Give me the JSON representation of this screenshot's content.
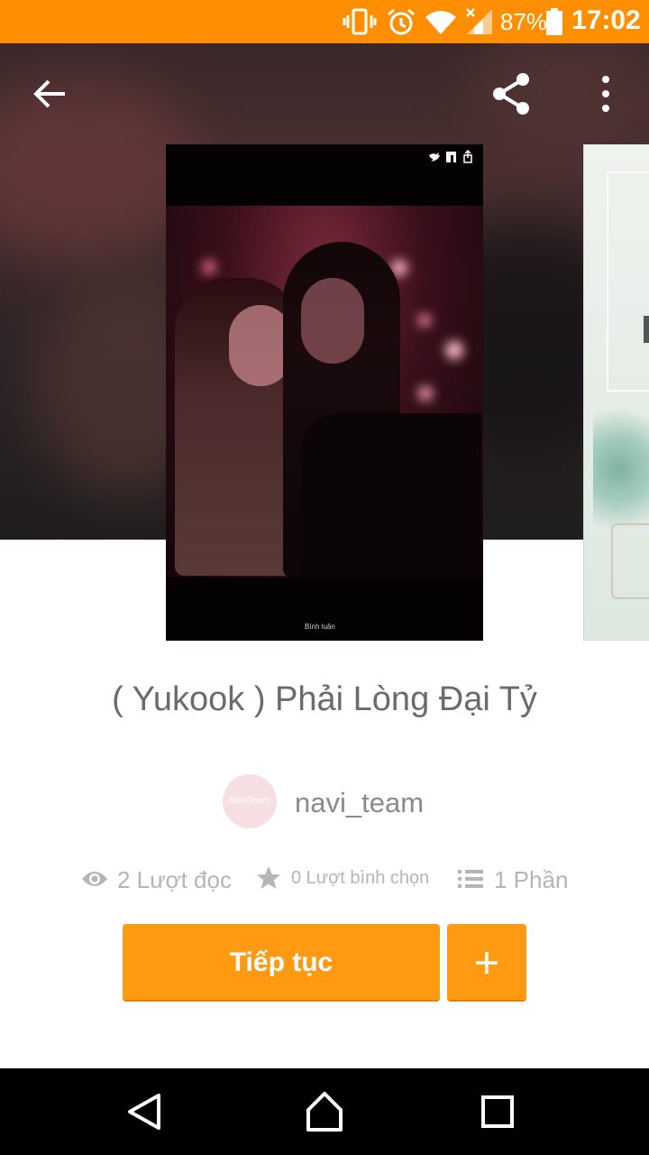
{
  "status_bar": {
    "icons": [
      "vibrate-icon",
      "alarm-icon",
      "wifi-icon",
      "signal-icon",
      "battery-icon"
    ],
    "battery": "87%",
    "time": "17:02"
  },
  "top_bar": {
    "back_icon": "arrow-left-icon",
    "share_icon": "share-icon",
    "more_icon": "more-vert-icon"
  },
  "cover": {
    "comment_label": "Bình luận"
  },
  "story": {
    "title": "( Yukook ) Phải Lòng Đại Tỷ",
    "author": "navi_team",
    "avatar_text": "NaviTeam"
  },
  "stats": {
    "reads": "2 Lượt đọc",
    "votes": "0 Lượt bình chọn",
    "parts": "1 Phần"
  },
  "actions": {
    "continue_label": "Tiếp tục",
    "add_icon": "plus-icon"
  },
  "colors": {
    "accent": "#ff9a12",
    "status_bar": "#ff8f00"
  }
}
